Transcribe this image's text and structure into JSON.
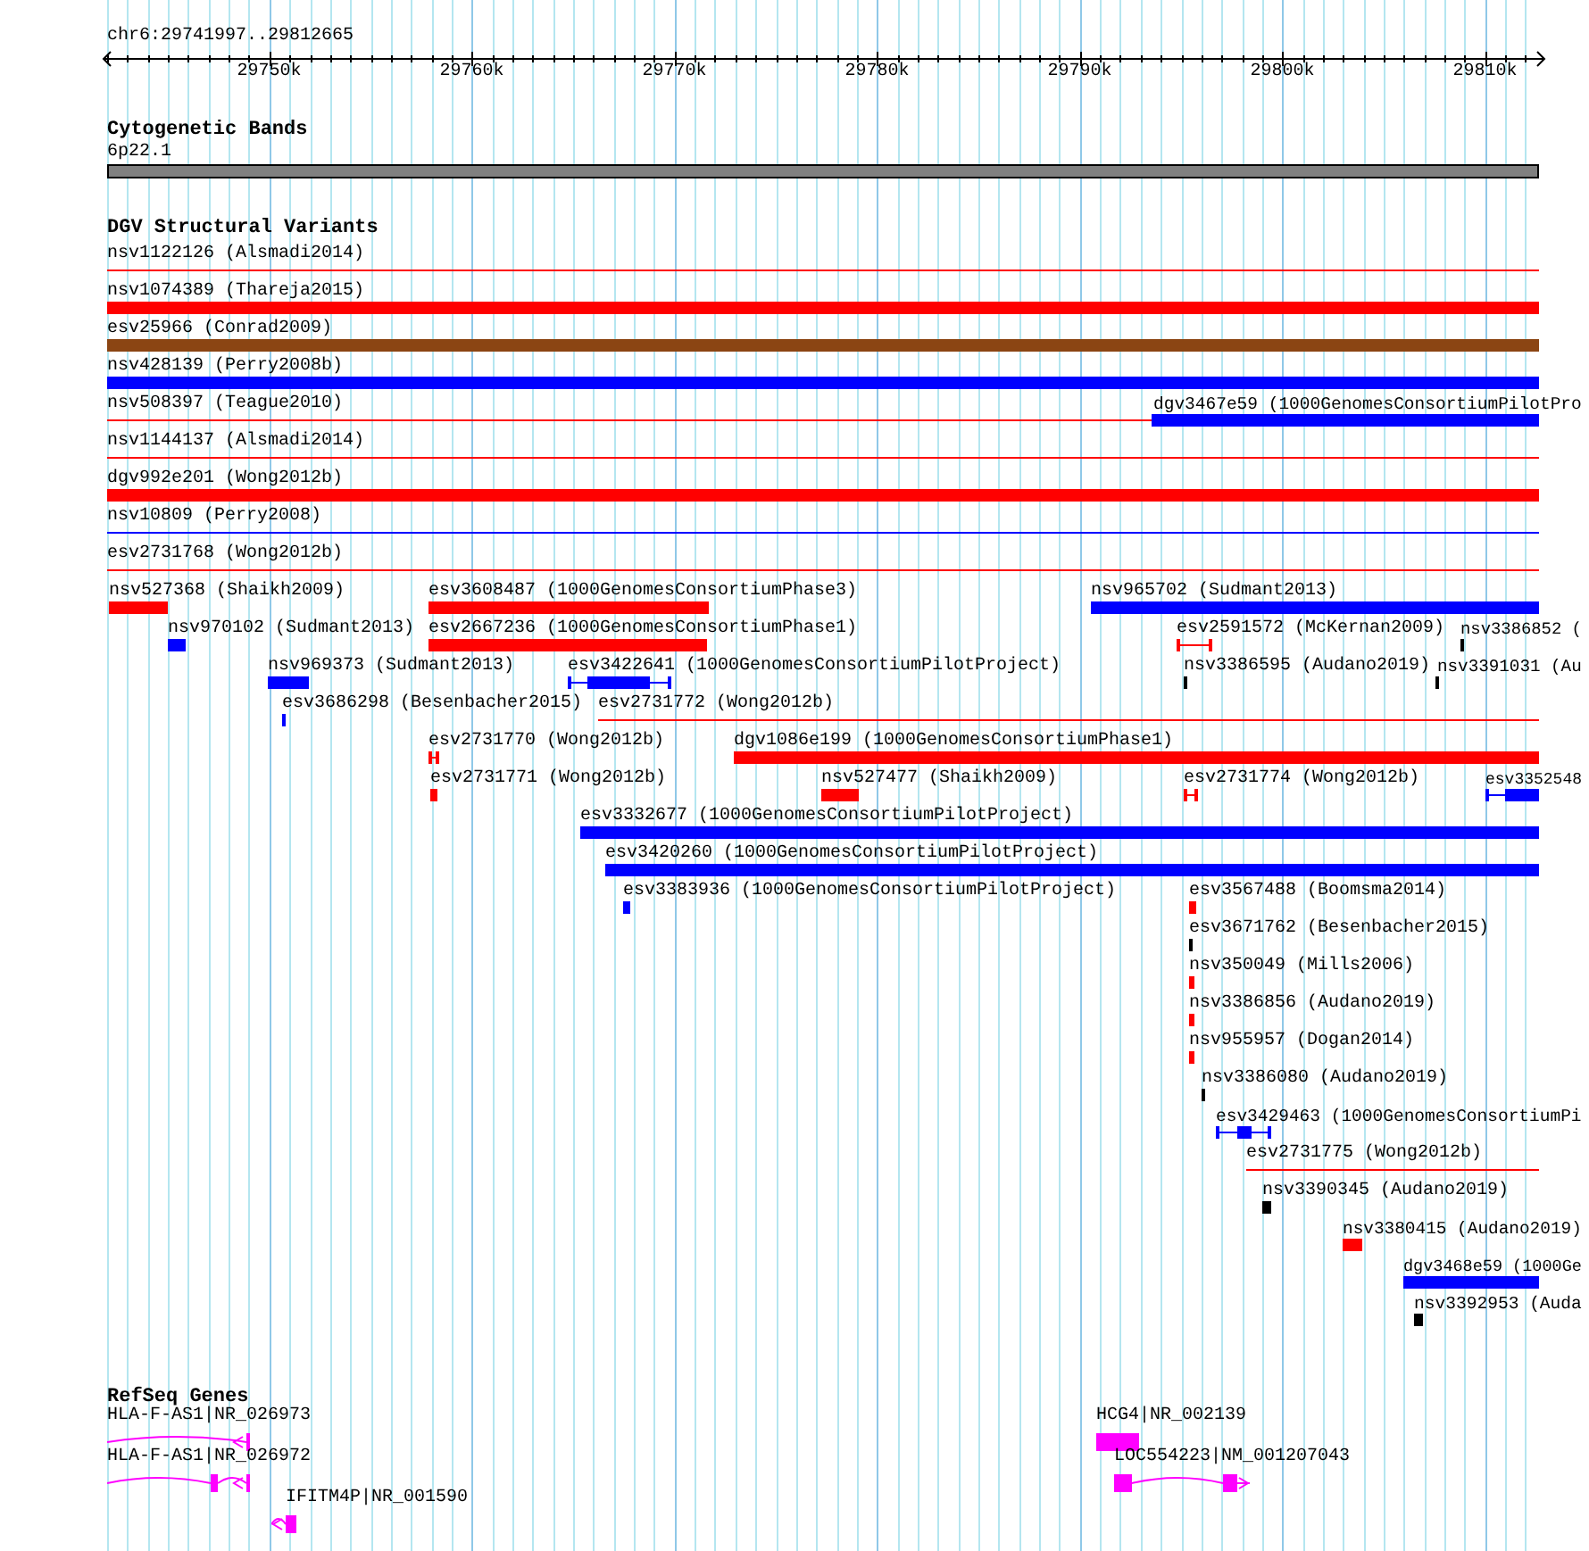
{
  "ruler": {
    "location": "chr6:29741997..29812665",
    "ticks": [
      "29750k",
      "29760k",
      "29770k",
      "29780k",
      "29790k",
      "29800k",
      "29810k"
    ]
  },
  "cytogenetic_bands": {
    "title": "Cytogenetic Bands",
    "band": "6p22.1"
  },
  "dgv": {
    "title": "DGV Structural Variants",
    "rows": [
      {
        "features": [
          {
            "label": "nsv1122126 (Alsmadi2014)",
            "kind": "line",
            "color": "#ff0000"
          }
        ]
      },
      {
        "features": [
          {
            "label": "nsv1074389 (Thareja2015)",
            "kind": "bar",
            "color": "#ff0000"
          }
        ]
      },
      {
        "features": [
          {
            "label": "esv25966 (Conrad2009)",
            "kind": "bar",
            "color": "#8b4513"
          }
        ]
      },
      {
        "features": [
          {
            "label": "nsv428139 (Perry2008b)",
            "kind": "bar",
            "color": "#0000ff"
          }
        ]
      },
      {
        "features": [
          {
            "label": "nsv508397 (Teague2010)",
            "kind": "line",
            "color": "#ff0000"
          },
          {
            "label": "dgv3467e59 (1000GenomesConsortiumPilotPro",
            "kind": "bar",
            "color": "#0000ff"
          }
        ]
      },
      {
        "features": [
          {
            "label": "nsv1144137 (Alsmadi2014)",
            "kind": "line",
            "color": "#ff0000"
          }
        ]
      },
      {
        "features": [
          {
            "label": "dgv992e201 (Wong2012b)",
            "kind": "bar",
            "color": "#ff0000"
          }
        ]
      },
      {
        "features": [
          {
            "label": "nsv10809 (Perry2008)",
            "kind": "line",
            "color": "#0000ff"
          }
        ]
      },
      {
        "features": [
          {
            "label": "esv2731768 (Wong2012b)",
            "kind": "line",
            "color": "#ff0000"
          }
        ]
      },
      {
        "features": [
          {
            "label": "nsv527368 (Shaikh2009)",
            "kind": "bar",
            "color": "#ff0000"
          },
          {
            "label": "esv3608487 (1000GenomesConsortiumPhase3)",
            "kind": "bar",
            "color": "#ff0000"
          },
          {
            "label": "nsv965702 (Sudmant2013)",
            "kind": "bar",
            "color": "#0000ff"
          }
        ]
      },
      {
        "features": [
          {
            "label": "nsv970102 (Sudmant2013)",
            "kind": "bar",
            "color": "#0000ff"
          },
          {
            "label": "esv2667236 (1000GenomesConsortiumPhase1)",
            "kind": "bar",
            "color": "#ff0000"
          },
          {
            "label": "esv2591572 (McKernan2009)",
            "kind": "whisker",
            "color": "#ff0000"
          },
          {
            "label": "nsv3386852 (",
            "kind": "bar",
            "color": "#000000"
          }
        ]
      },
      {
        "features": [
          {
            "label": "nsv969373 (Sudmant2013)",
            "kind": "bar",
            "color": "#0000ff"
          },
          {
            "label": "esv3422641 (1000GenomesConsortiumPilotProject)",
            "kind": "whisker",
            "color": "#0000ff"
          },
          {
            "label": "nsv3386595 (Audano2019)",
            "kind": "bar",
            "color": "#000000"
          },
          {
            "label": "nsv3391031 (Au",
            "kind": "bar",
            "color": "#000000"
          }
        ]
      },
      {
        "features": [
          {
            "label": "esv3686298 (Besenbacher2015)",
            "kind": "bar",
            "color": "#0000ff"
          },
          {
            "label": "esv2731772 (Wong2012b)",
            "kind": "line",
            "color": "#ff0000"
          }
        ]
      },
      {
        "features": [
          {
            "label": "esv2731770 (Wong2012b)",
            "kind": "whisker",
            "color": "#ff0000"
          },
          {
            "label": "dgv1086e199 (1000GenomesConsortiumPhase1)",
            "kind": "bar",
            "color": "#ff0000"
          }
        ]
      },
      {
        "features": [
          {
            "label": "esv2731771 (Wong2012b)",
            "kind": "bar",
            "color": "#ff0000"
          },
          {
            "label": "nsv527477 (Shaikh2009)",
            "kind": "bar",
            "color": "#ff0000"
          },
          {
            "label": "esv2731774 (Wong2012b)",
            "kind": "whisker",
            "color": "#ff0000"
          },
          {
            "label": "esv3352548",
            "kind": "whisker",
            "color": "#0000ff"
          }
        ]
      },
      {
        "features": [
          {
            "label": "esv3332677 (1000GenomesConsortiumPilotProject)",
            "kind": "bar",
            "color": "#0000ff"
          }
        ]
      },
      {
        "features": [
          {
            "label": "esv3420260 (1000GenomesConsortiumPilotProject)",
            "kind": "bar",
            "color": "#0000ff"
          }
        ]
      },
      {
        "features": [
          {
            "label": "esv3383936 (1000GenomesConsortiumPilotProject)",
            "kind": "bar",
            "color": "#0000ff"
          },
          {
            "label": "esv3567488 (Boomsma2014)",
            "kind": "bar",
            "color": "#ff0000"
          }
        ]
      },
      {
        "features": [
          {
            "label": "esv3671762 (Besenbacher2015)",
            "kind": "bar",
            "color": "#000000"
          }
        ]
      },
      {
        "features": [
          {
            "label": "nsv350049 (Mills2006)",
            "kind": "bar",
            "color": "#ff0000"
          }
        ]
      },
      {
        "features": [
          {
            "label": "nsv3386856 (Audano2019)",
            "kind": "bar",
            "color": "#ff0000"
          }
        ]
      },
      {
        "features": [
          {
            "label": "nsv955957 (Dogan2014)",
            "kind": "bar",
            "color": "#ff0000"
          }
        ]
      },
      {
        "features": [
          {
            "label": "nsv3386080 (Audano2019)",
            "kind": "bar",
            "color": "#000000"
          }
        ]
      },
      {
        "features": [
          {
            "label": "esv3429463 (1000GenomesConsortiumPi",
            "kind": "whisker",
            "color": "#0000ff"
          }
        ]
      },
      {
        "features": [
          {
            "label": "esv2731775 (Wong2012b)",
            "kind": "line",
            "color": "#ff0000"
          }
        ]
      },
      {
        "features": [
          {
            "label": "nsv3390345 (Audano2019)",
            "kind": "bar",
            "color": "#000000"
          }
        ]
      },
      {
        "features": [
          {
            "label": "nsv3380415 (Audano2019)",
            "kind": "bar",
            "color": "#ff0000"
          }
        ]
      },
      {
        "features": [
          {
            "label": "dgv3468e59 (1000Ge",
            "kind": "bar",
            "color": "#0000ff"
          }
        ]
      },
      {
        "features": [
          {
            "label": "nsv3392953 (Auda",
            "kind": "bar",
            "color": "#000000"
          }
        ]
      }
    ]
  },
  "refseq": {
    "title": "RefSeq Genes",
    "rows": [
      {
        "genes": [
          {
            "label": "HLA-F-AS1|NR_026973",
            "kind": "transcript",
            "reverse": true
          },
          {
            "label": "HCG4|NR_002139",
            "kind": "block"
          }
        ]
      },
      {
        "genes": [
          {
            "label": "HLA-F-AS1|NR_026972",
            "kind": "transcript",
            "reverse": true
          },
          {
            "label": "LOC554223|NM_001207043",
            "kind": "transcript",
            "reverse": false
          }
        ]
      },
      {
        "genes": [
          {
            "label": "IFITM4P|NR_001590",
            "kind": "transcript",
            "reverse": true
          }
        ]
      }
    ]
  }
}
